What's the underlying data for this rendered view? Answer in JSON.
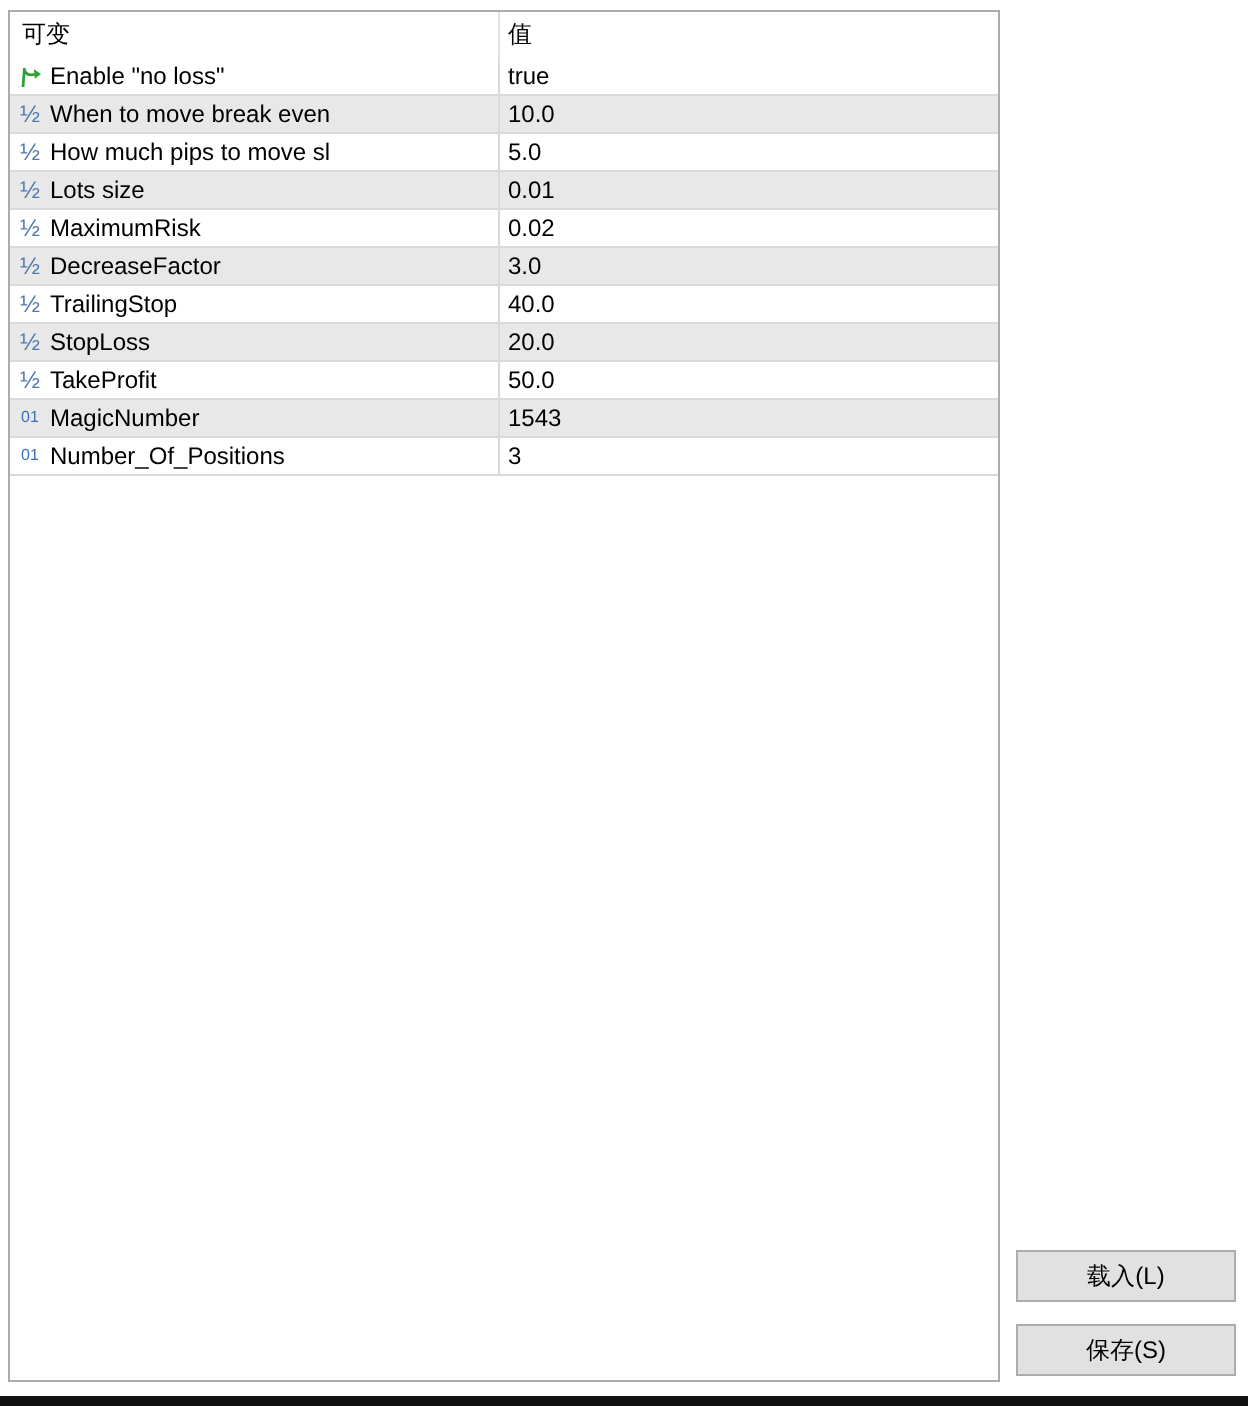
{
  "columns": [
    {
      "label": "可变"
    },
    {
      "label": "值"
    }
  ],
  "rows": [
    {
      "kind": "bool",
      "name": "Enable \"no loss\"",
      "value": "true"
    },
    {
      "kind": "double",
      "type_mark": "½",
      "name": "When to move break even",
      "value": "10.0"
    },
    {
      "kind": "double",
      "type_mark": "½",
      "name": "How much pips to move sl",
      "value": "5.0"
    },
    {
      "kind": "double",
      "type_mark": "½",
      "name": "Lots size",
      "value": "0.01"
    },
    {
      "kind": "double",
      "type_mark": "½",
      "name": "MaximumRisk",
      "value": "0.02"
    },
    {
      "kind": "double",
      "type_mark": "½",
      "name": "DecreaseFactor",
      "value": "3.0"
    },
    {
      "kind": "double",
      "type_mark": "½",
      "name": "TrailingStop",
      "value": "40.0"
    },
    {
      "kind": "double",
      "type_mark": "½",
      "name": "StopLoss",
      "value": "20.0"
    },
    {
      "kind": "double",
      "type_mark": "½",
      "name": "TakeProfit",
      "value": "50.0"
    },
    {
      "kind": "int",
      "type_mark": "01",
      "name": "MagicNumber",
      "value": "1543"
    },
    {
      "kind": "int",
      "type_mark": "01",
      "name": "Number_Of_Positions",
      "value": "3"
    }
  ],
  "buttons": [
    {
      "label": "载入(L)"
    },
    {
      "label": "保存(S)"
    }
  ]
}
